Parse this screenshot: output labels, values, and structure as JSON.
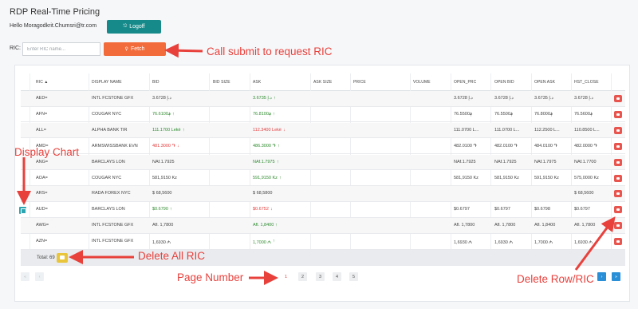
{
  "app": {
    "title": "RDP Real-Time Pricing"
  },
  "user": {
    "greeting": "Hello Moragodkrit.Chumsri@tr.com",
    "logoff_label": "Logoff"
  },
  "ric_form": {
    "label": "RIC:",
    "placeholder": "Enter RIC name...",
    "fetch_label": "Fetch"
  },
  "table": {
    "columns": [
      "RIC",
      "DISPLAY NAME",
      "BID",
      "BID SIZE",
      "ASK",
      "ASK SIZE",
      "PRICE",
      "VOLUME",
      "OPEN_PRC",
      "OPEN BID",
      "OPEN ASK",
      "HST_CLOSE"
    ],
    "sort_column": "RIC",
    "rows": [
      {
        "ric": "AED=",
        "name": "INTL FCSTONE GFX",
        "bid": "3.6728 د.إ",
        "bid_trend": "",
        "ask": "3.6735 د.إ",
        "ask_trend": "up",
        "open_prc": "3.6728 د.إ",
        "open_bid": "3.6728 د.إ",
        "open_ask": "3.6735 د.إ",
        "hst_close": "3.6728 د.إ"
      },
      {
        "ric": "AFN=",
        "name": "COUGAR NYC",
        "bid": "76.6100؋",
        "bid_trend": "up",
        "ask": "76.8100؋",
        "ask_trend": "up",
        "open_prc": "76.5500؋",
        "open_bid": "76.5500؋",
        "open_ask": "76.8000؋",
        "hst_close": "76.5600؋"
      },
      {
        "ric": "ALL=",
        "name": "ALPHA BANK TIR",
        "bid": "111.1700 Lekë",
        "bid_trend": "up",
        "ask": "112.3400 Lekë",
        "ask_trend": "down",
        "open_prc": "111.0700 L...",
        "open_bid": "111.0700 L...",
        "open_ask": "112.2500 L...",
        "hst_close": "110.8500 L..."
      },
      {
        "ric": "AMD=",
        "name": "ARMSWISSBANK EVN",
        "bid": "481.3000 ֏",
        "bid_trend": "down",
        "ask": "486.3000 ֏",
        "ask_trend": "up",
        "open_prc": "482.0100 ֏",
        "open_bid": "482.0100 ֏",
        "open_ask": "484.0100 ֏",
        "hst_close": "482.0000 ֏"
      },
      {
        "ric": "ANG=",
        "name": "BARCLAYS LON",
        "bid": "NAf.1.7925",
        "bid_trend": "",
        "ask": "NAf.1.7975",
        "ask_trend": "up",
        "open_prc": "NAf.1.7925",
        "open_bid": "NAf.1.7925",
        "open_ask": "NAf.1.7975",
        "hst_close": "NAf.1.7700"
      },
      {
        "ric": "AOA=",
        "name": "COUGAR NYC",
        "bid": "581,9150 Kz",
        "bid_trend": "",
        "ask": "591,9150 Kz",
        "ask_trend": "up",
        "open_prc": "581,9150 Kz",
        "open_bid": "581,9150 Kz",
        "open_ask": "591,9150 Kz",
        "hst_close": "575,0000 Kz"
      },
      {
        "ric": "ARS=",
        "name": "RADA FOREX NYC",
        "bid": "$ 68,5600",
        "bid_trend": "",
        "ask": "$ 68,5800",
        "ask_trend": "",
        "open_prc": "",
        "open_bid": "",
        "open_ask": "",
        "hst_close": "$ 68,5600"
      },
      {
        "ric": "AUD=",
        "name": "BARCLAYS LON",
        "bid": "$0.6790",
        "bid_trend": "up",
        "ask": "$0.6752",
        "ask_trend": "down",
        "open_prc": "$0.6797",
        "open_bid": "$0.6797",
        "open_ask": "$0.6798",
        "hst_close": "$0.6797"
      },
      {
        "ric": "AWG=",
        "name": "INTL FCSTONE GFX",
        "bid": "Afl. 1,7800",
        "bid_trend": "",
        "ask": "Afl. 1,8400",
        "ask_trend": "up",
        "open_prc": "Afl. 1,7800",
        "open_bid": "Afl. 1,7800",
        "open_ask": "Afl. 1,8400",
        "hst_close": "Afl. 1,7800"
      },
      {
        "ric": "AZN=",
        "name": "INTL FCSTONE GFX",
        "bid": "1,6930 ₼",
        "bid_trend": "",
        "ask": "1,7000 ₼",
        "ask_trend": "up",
        "open_prc": "1,6930 ₼",
        "open_bid": "1,6930 ₼",
        "open_ask": "1,7000 ₼",
        "hst_close": "1,6930 ₼"
      }
    ],
    "total_label": "Total: 69"
  },
  "pagination": {
    "prev_labels": [
      "«",
      "‹"
    ],
    "pages": [
      "1",
      "2",
      "3",
      "4",
      "5"
    ],
    "active_page": "1",
    "next_labels": [
      "›",
      "»"
    ]
  },
  "annotations": {
    "call_submit": "Call submit to request RIC",
    "display_chart": "Display Chart",
    "delete_all": "Delete All RIC",
    "page_number": "Page Number",
    "delete_row": "Delete Row/RIC"
  },
  "colors": {
    "teal": "#168a8a",
    "orange": "#f26b3a",
    "up": "#2e8b2e",
    "down": "#e33b3b",
    "annotation": "#e8413c",
    "delete": "#e8554e",
    "delete_all": "#e9c53b"
  },
  "icons": {
    "logoff": "logout-icon",
    "fetch": "search-icon",
    "chart": "chart-icon",
    "delete": "delete-icon",
    "delete_all": "delete-all-icon",
    "sort": "sort-asc-icon"
  }
}
